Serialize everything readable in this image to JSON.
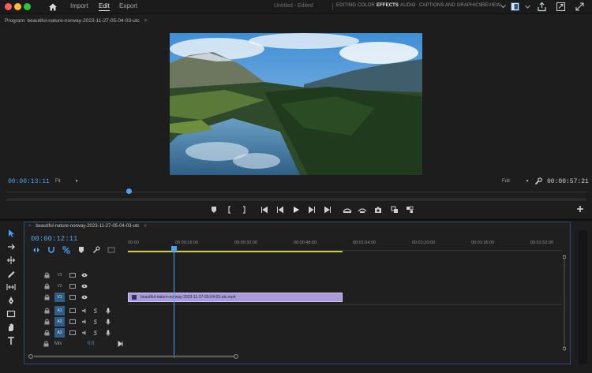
{
  "topbar": {
    "tabs": [
      "Import",
      "Edit",
      "Export"
    ],
    "active_tab": "Edit",
    "project_title": "Untitled - Edited",
    "workspaces": [
      "EDITING",
      "COLOR",
      "EFFECTS",
      "AUDIO",
      "CAPTIONS AND GRAPHICS",
      "REVIEW"
    ],
    "active_workspace": "EFFECTS"
  },
  "program_monitor": {
    "label": "Program: beautiful-nature-norway-2023-11-27-05-04-03-utc",
    "timecode_current": "00:00:13:11",
    "fit": "Fit",
    "resolution": "Full",
    "timecode_duration": "00:00:57:21"
  },
  "timeline": {
    "sequence_name": "beautiful-nature-norway-2023-11-27-05-04-03-utc",
    "timecode": "00:00:12:11",
    "ruler_ticks": [
      "00:00",
      "00:00:16:00",
      "00:00:32:00",
      "00:00:48:00",
      "00:01:04:00",
      "00:01:20:00",
      "00:01:36:00",
      "00:01:52:00"
    ],
    "tracks": [
      {
        "name": "V3",
        "target": false
      },
      {
        "name": "V2",
        "target": false
      },
      {
        "name": "V1",
        "target": true
      },
      {
        "name": "A1",
        "target": true
      },
      {
        "name": "A2",
        "target": true
      },
      {
        "name": "A3",
        "target": true
      }
    ],
    "mix_label": "Mix",
    "mix_value": "0.0",
    "clip_label": "beautiful-nature-norway-2023-11-27-05-04-03-utc.mp4"
  },
  "colors": {
    "accent_blue": "#4aa3f0",
    "clip_purple": "#a99bd9",
    "work_area": "#c8c84a",
    "mac_red": "#ff5f57",
    "mac_yellow": "#febc2e",
    "mac_green": "#28c840"
  }
}
